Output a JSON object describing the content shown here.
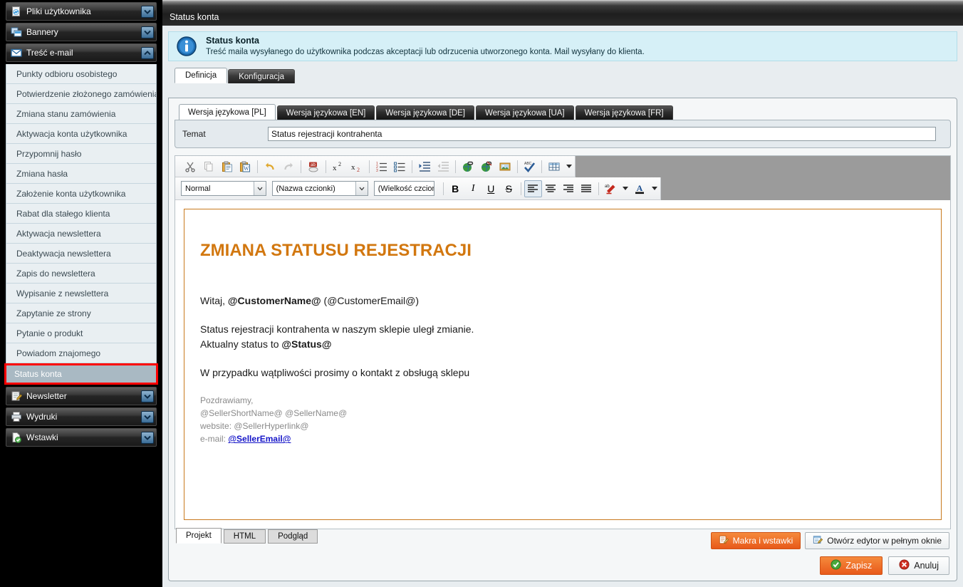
{
  "sidebar": {
    "groups": [
      {
        "label": "Pliki użytkownika",
        "icon": "file-refresh-icon",
        "expanded": false
      },
      {
        "label": "Bannery",
        "icon": "banners-icon",
        "expanded": false
      },
      {
        "label": "Treść e-mail",
        "icon": "envelope-icon",
        "expanded": true
      }
    ],
    "items": [
      {
        "label": "Punkty odbioru osobistego",
        "selected": false
      },
      {
        "label": "Potwierdzenie złożonego zamówienia",
        "selected": false
      },
      {
        "label": "Zmiana stanu zamówienia",
        "selected": false
      },
      {
        "label": "Aktywacja konta użytkownika",
        "selected": false
      },
      {
        "label": "Przypomnij hasło",
        "selected": false
      },
      {
        "label": "Zmiana hasła",
        "selected": false
      },
      {
        "label": "Założenie konta użytkownika",
        "selected": false
      },
      {
        "label": "Rabat dla stałego klienta",
        "selected": false
      },
      {
        "label": "Aktywacja newslettera",
        "selected": false
      },
      {
        "label": "Deaktywacja newslettera",
        "selected": false
      },
      {
        "label": "Zapis do newslettera",
        "selected": false
      },
      {
        "label": "Wypisanie z newslettera",
        "selected": false
      },
      {
        "label": "Zapytanie ze strony",
        "selected": false
      },
      {
        "label": "Pytanie o produkt",
        "selected": false
      },
      {
        "label": "Powiadom znajomego",
        "selected": false
      },
      {
        "label": "Status konta",
        "selected": true
      }
    ],
    "groups_bottom": [
      {
        "label": "Newsletter",
        "icon": "newsletter-icon",
        "expanded": false
      },
      {
        "label": "Wydruki",
        "icon": "printer-icon",
        "expanded": false
      },
      {
        "label": "Wstawki",
        "icon": "insert-icon",
        "expanded": false
      }
    ]
  },
  "window": {
    "title": "Status konta"
  },
  "info": {
    "icon": "info-icon",
    "title": "Status konta",
    "description": "Treść maila wysyłanego do użytkownika podczas akceptacji lub odrzucenia utworzonego konta. Mail wysyłany do klienta."
  },
  "main_tabs": [
    {
      "label": "Definicja",
      "active": true
    },
    {
      "label": "Konfiguracja",
      "active": false
    }
  ],
  "lang_tabs": [
    {
      "label": "Wersja językowa [PL]",
      "active": true
    },
    {
      "label": "Wersja językowa [EN]",
      "active": false
    },
    {
      "label": "Wersja językowa [DE]",
      "active": false
    },
    {
      "label": "Wersja językowa [UA]",
      "active": false
    },
    {
      "label": "Wersja językowa [FR]",
      "active": false
    }
  ],
  "subject": {
    "label": "Temat",
    "value": "Status rejestracji kontrahenta",
    "placeholder": ""
  },
  "editor": {
    "toolbar_row1": [
      {
        "name": "cut-icon",
        "title": "Wytnij"
      },
      {
        "name": "copy-icon",
        "title": "Kopiuj"
      },
      {
        "name": "paste-icon",
        "title": "Wklej"
      },
      {
        "name": "paste-from-word-icon",
        "title": "Wklej z Worda"
      },
      {
        "name": "undo-icon",
        "title": "Cofnij"
      },
      {
        "name": "redo-icon",
        "title": "Ponów"
      },
      {
        "name": "find-replace-icon",
        "title": "Znajdź i zamień"
      },
      {
        "name": "superscript-icon",
        "title": "Indeks górny"
      },
      {
        "name": "subscript-icon",
        "title": "Indeks dolny"
      },
      {
        "name": "ordered-list-icon",
        "title": "Lista numerowana"
      },
      {
        "name": "unordered-list-icon",
        "title": "Lista punktowana"
      },
      {
        "name": "indent-increase-icon",
        "title": "Zwiększ wcięcie"
      },
      {
        "name": "indent-decrease-icon",
        "title": "Zmniejsz wcięcie"
      },
      {
        "name": "insert-link-icon",
        "title": "Wstaw odnośnik"
      },
      {
        "name": "remove-link-icon",
        "title": "Usuń odnośnik"
      },
      {
        "name": "insert-image-icon",
        "title": "Wstaw obrazek"
      },
      {
        "name": "spellcheck-icon",
        "title": "Sprawdź pisownię"
      },
      {
        "name": "insert-table-icon",
        "title": "Wstaw tabelę"
      }
    ],
    "style_select": {
      "value": "Normal",
      "name": "paragraph-style-select"
    },
    "font_select": {
      "value": "(Nazwa czcionki)",
      "name": "font-name-select"
    },
    "size_select": {
      "value": "(Wielkość czcionki)",
      "name": "font-size-select"
    },
    "format_buttons": [
      {
        "name": "bold-button",
        "label": "B"
      },
      {
        "name": "italic-button",
        "label": "I"
      },
      {
        "name": "underline-button",
        "label": "U"
      },
      {
        "name": "strikethrough-button",
        "label": "S"
      }
    ],
    "align_buttons": [
      {
        "name": "align-left-button",
        "active": true
      },
      {
        "name": "align-center-button",
        "active": false
      },
      {
        "name": "align-right-button",
        "active": false
      },
      {
        "name": "align-justify-button",
        "active": false
      }
    ],
    "highlight_button": {
      "name": "text-highlight-button"
    },
    "fontcolor_button": {
      "name": "font-color-button"
    }
  },
  "mail": {
    "heading": "ZMIANA STATUSU REJESTRACJI",
    "greeting_prefix": "Witaj, ",
    "greeting_name": "@CustomerName@",
    "greeting_email": " (@CustomerEmail@)",
    "body_line1": "Status rejestracji kontrahenta w naszym sklepie uległ zmianie.",
    "body_line2_prefix": "Aktualny status to ",
    "body_line2_token": "@Status@",
    "body_line3": "W przypadku wątpliwości prosimy o kontakt z obsługą sklepu",
    "sig_line1": "Pozdrawiamy,",
    "sig_line2": "@SellerShortName@ @SellerName@",
    "sig_line3_label": "website: ",
    "sig_line3_token": "@SellerHyperlink@",
    "sig_line4_label": "e-mail: ",
    "sig_line4_link": "@SellerEmail@"
  },
  "view_tabs": [
    {
      "label": "Projekt",
      "active": true
    },
    {
      "label": "HTML",
      "active": false
    },
    {
      "label": "Podgląd",
      "active": false
    }
  ],
  "editor_buttons": {
    "macros": {
      "label": "Makra i wstawki",
      "icon": "macro-icon"
    },
    "fullscreen": {
      "label": "Otwórz edytor w pełnym oknie",
      "icon": "editor-window-icon"
    }
  },
  "footer_buttons": {
    "save": {
      "label": "Zapisz",
      "icon": "check-circle-icon"
    },
    "cancel": {
      "label": "Anuluj",
      "icon": "cancel-circle-icon"
    }
  },
  "colors": {
    "accent_orange": "#e8591a",
    "heading_orange": "#d2770f",
    "selection_red": "#ff0000",
    "info_bg": "#d6f0f7",
    "link_blue": "#1414c8"
  }
}
